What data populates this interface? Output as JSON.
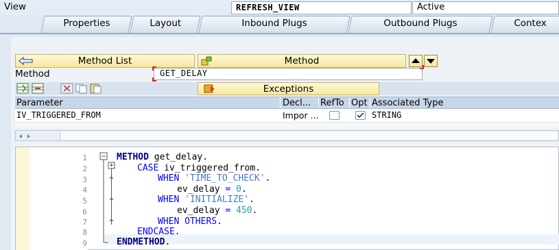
{
  "header": {
    "label": "View",
    "view_name": "REFRESH_VIEW",
    "status": "Active"
  },
  "tabs": [
    {
      "label": "Properties"
    },
    {
      "label": "Layout"
    },
    {
      "label": "Inbound Plugs"
    },
    {
      "label": "Outbound Plugs"
    },
    {
      "label": "Contex"
    }
  ],
  "toolbar": {
    "method_list_label": "Method List",
    "method_label": "Method",
    "exceptions_label": "Exceptions"
  },
  "method_field": {
    "label": "Method",
    "value": "GET_DELAY"
  },
  "table": {
    "columns": [
      "Parameter",
      "Decl...",
      "RefTo",
      "Opt",
      "Associated Type"
    ],
    "rows": [
      {
        "parameter": "IV_TRIGGERED_FROM",
        "decl": "Impor ...",
        "refto": false,
        "opt": true,
        "type": "STRING"
      }
    ]
  },
  "code": {
    "line_numbers": [
      "1",
      "2",
      "3",
      "4",
      "5",
      "6",
      "7",
      "8",
      "9"
    ],
    "lines": [
      {
        "kw1": "METHOD",
        "rest": " get_delay."
      },
      {
        "kw1": "CASE",
        "rest": " iv_triggered_from."
      },
      {
        "kw1": "WHEN",
        "str": "'TIME_TO_CHECK'",
        "rest": "."
      },
      {
        "var": "ev_delay",
        "op": " = ",
        "num": "0",
        "rest": "."
      },
      {
        "kw1": "WHEN",
        "str": "'INITIALIZE'",
        "rest": "."
      },
      {
        "var": "ev_delay",
        "op": " = ",
        "num": "450",
        "rest": "."
      },
      {
        "kw1": "WHEN",
        "kw2": "OTHERS",
        "rest": "."
      },
      {
        "kw1": "ENDCASE",
        "rest": "."
      },
      {
        "kw1": "ENDMETHOD",
        "rest": "."
      }
    ]
  },
  "colors": {
    "keyword": "#0000ff",
    "string": "#4a78c4",
    "number": "#2aa0a0",
    "button_bg": "#f6e79a"
  }
}
